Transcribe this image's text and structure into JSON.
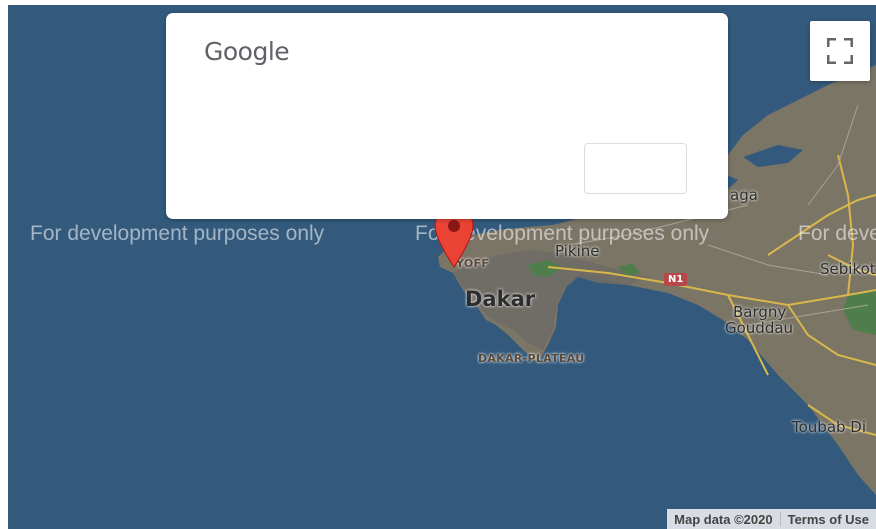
{
  "map": {
    "watermark_text": "For development purposes only",
    "labels": {
      "yoff": "YOFF",
      "pikine": "Pikine",
      "dakar": "Dakar",
      "dakar_plateau": "DAKAR-PLATEAU",
      "bargny": "Bargny",
      "gouddau": "Gouddau",
      "sebikot": "Sebikot",
      "toubab": "Toubab Di",
      "aga": "aga"
    },
    "road_shield": "N1",
    "colors": {
      "water": "#335a7c",
      "land": "#7b7566",
      "urban": "#6f6c66",
      "park": "#4f7e4c",
      "road": "#d9b74a",
      "pin": "#ea4335"
    }
  },
  "dialog": {
    "logo_text": "Google",
    "button_label": ""
  },
  "controls": {
    "fullscreen_icon": "fullscreen-icon"
  },
  "footer": {
    "map_data": "Map data ©2020",
    "terms": "Terms of Use"
  }
}
